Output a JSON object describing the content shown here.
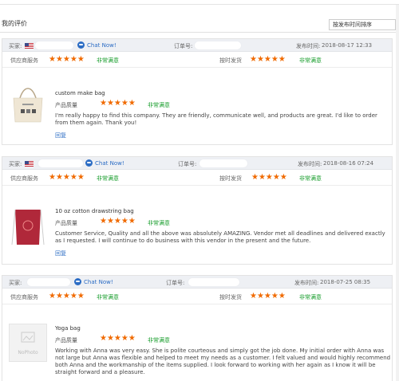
{
  "page": {
    "title": "我的评价",
    "sort_label": "按发布时间排序"
  },
  "labels": {
    "buyer": "买家:",
    "order": "订单号:",
    "posted": "发布时间:",
    "supplier_service": "供应商服务",
    "on_time": "按时发货",
    "product_quality": "产品质量",
    "reply": "回复",
    "chat": "Chat Now!"
  },
  "reviews": [
    {
      "posted_time": "2018-08-17 12:33",
      "supplier_rating": 5,
      "supplier_text": "非常满意",
      "ontime_rating": 5,
      "ontime_text": "非常满意",
      "product_name": "custom make bag",
      "quality_rating": 5,
      "quality_text": "非常满意",
      "comment": "I'm really happy to find this company. They are friendly, communicate well, and products are great. I'd like to order from them again. Thank you!",
      "has_flag": true
    },
    {
      "posted_time": "2018-08-16 07:24",
      "supplier_rating": 5,
      "supplier_text": "非常满意",
      "ontime_rating": 5,
      "ontime_text": "非常满意",
      "product_name": "10 oz cotton drawstring bag",
      "quality_rating": 5,
      "quality_text": "非常满意",
      "comment": "Customer Service, Quality and all the above was absolutely AMAZING. Vendor met all deadlines and delivered exactly as I requested. I will continue to do business with this vendor in the present and the future.",
      "has_flag": true
    },
    {
      "posted_time": "2018-07-25 08:35",
      "supplier_rating": 5,
      "supplier_text": "非常满意",
      "ontime_rating": 5,
      "ontime_text": "非常满意",
      "product_name": "Yoga bag",
      "quality_rating": 5,
      "quality_text": "非常满意",
      "comment": "Working with Anna was very easy. She is polite courteous and simply got the job done. My initial order with Anna was not large but Anna was flexible and helped to meet my needs as a customer. I felt valued and would highly recommend both Anna and the workmanship of the items supplied. I look forward to working with her again as I know it will be straight forward and a pleasure.",
      "has_flag": false,
      "no_photo_label": "NoPhoto"
    }
  ],
  "colors": {
    "star": "#f06a00",
    "satisfied": "#1a9e2e",
    "link": "#2b6cc4",
    "header_bg": "#eef0f4"
  }
}
